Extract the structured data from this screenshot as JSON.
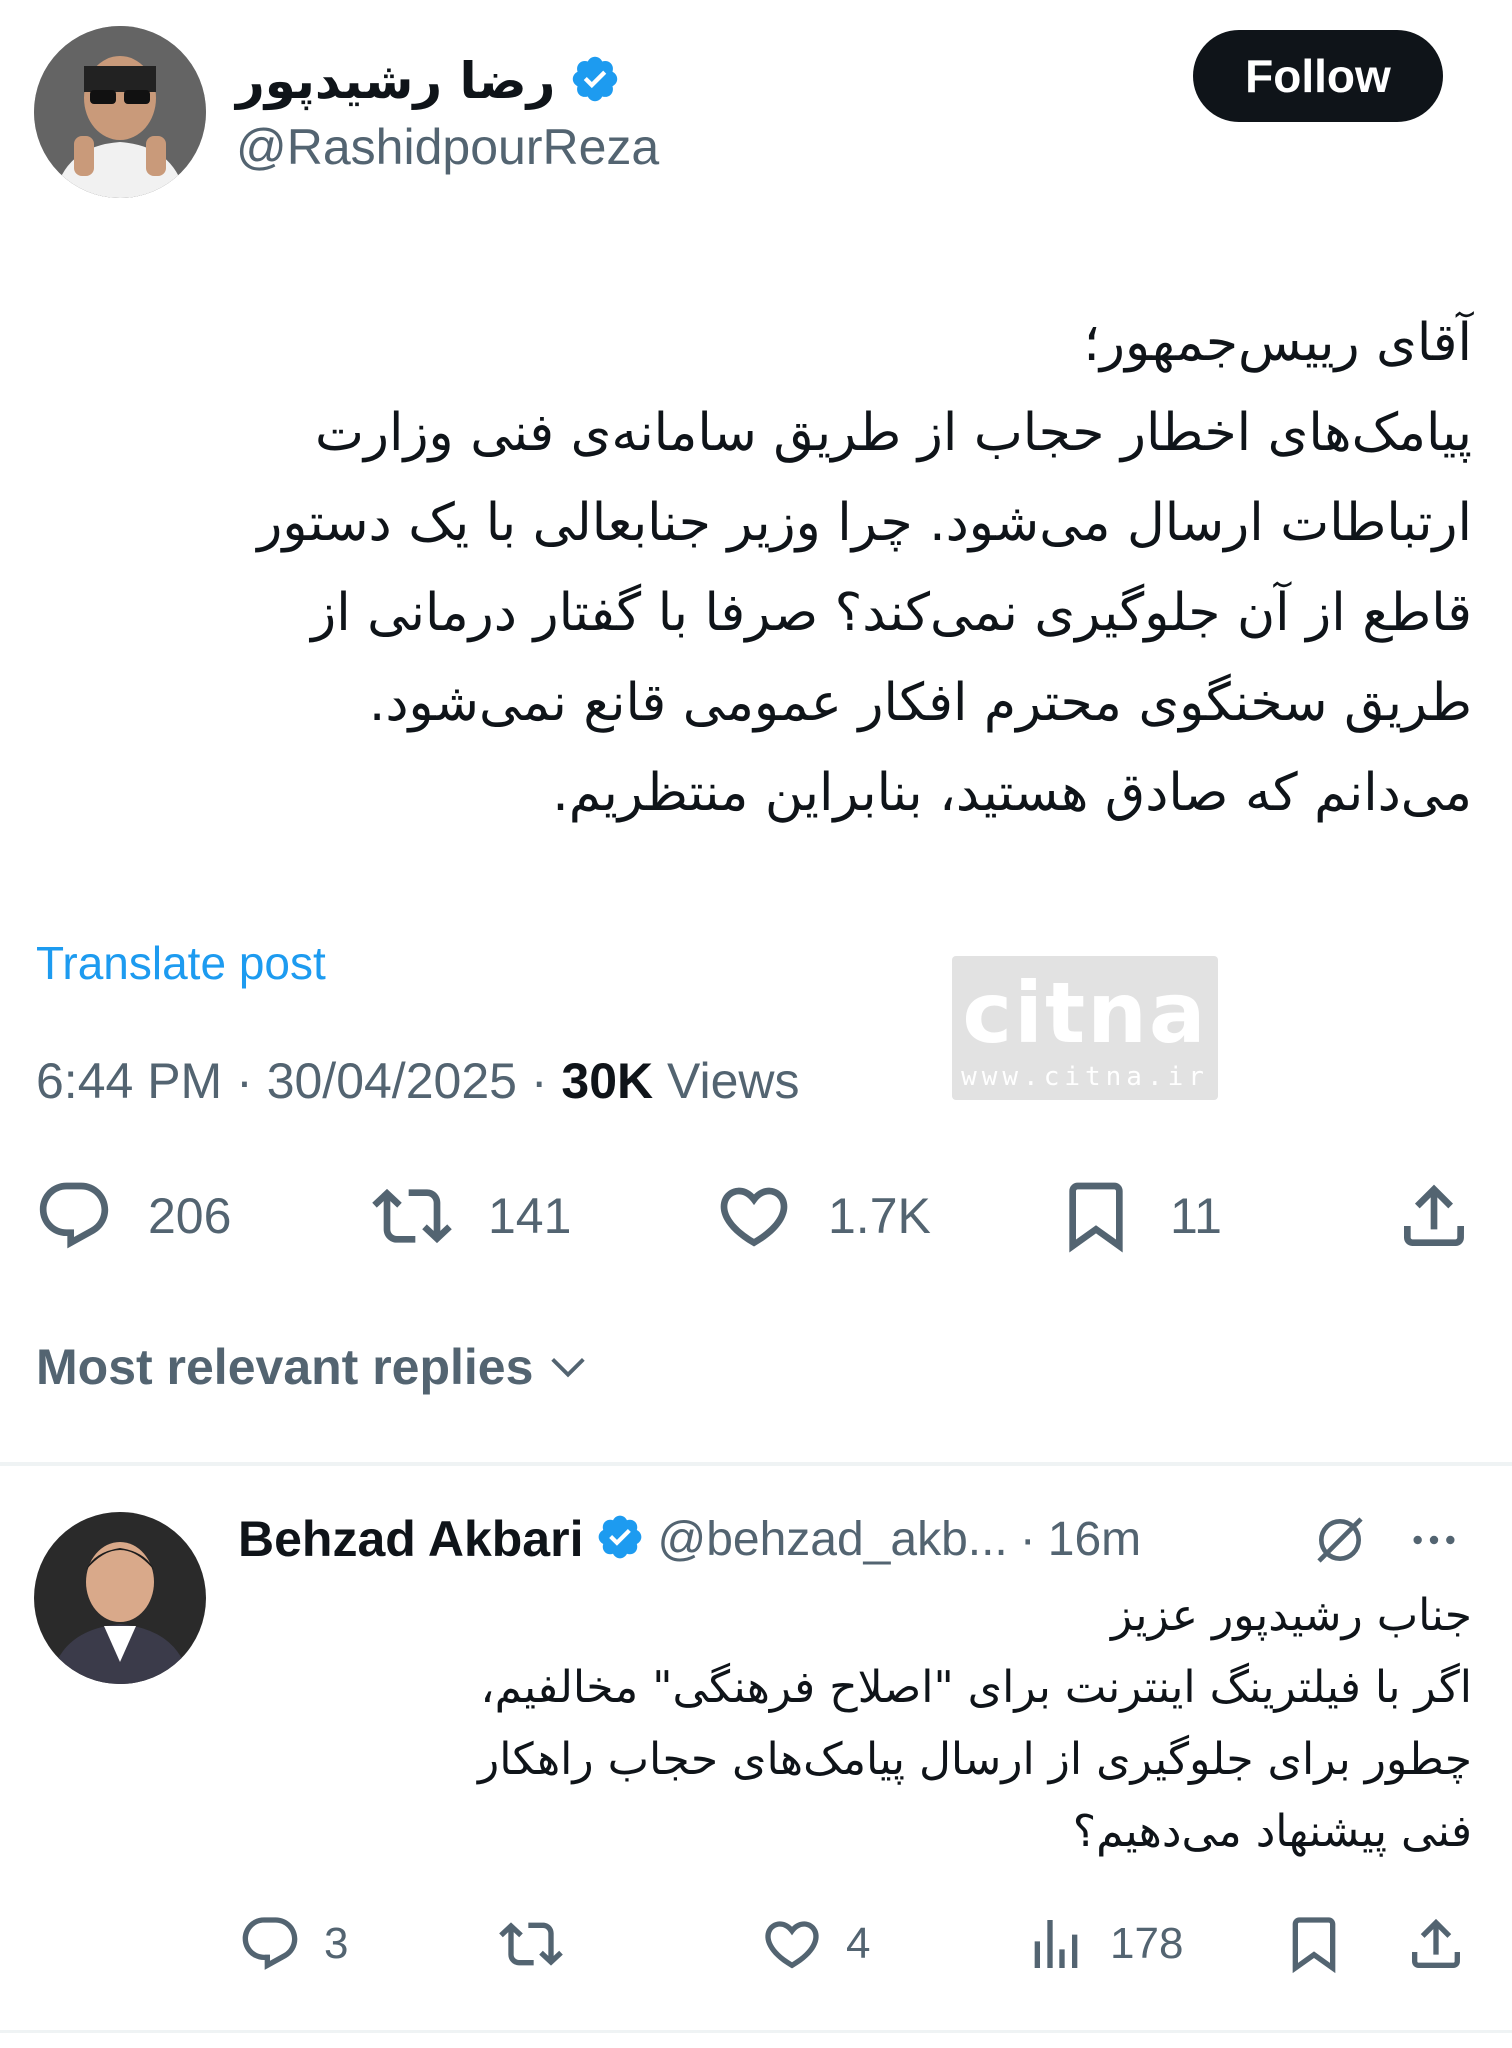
{
  "author": {
    "display_name": "رضا رشیدپور",
    "handle": "@RashidpourReza",
    "avatar_icon": "person-avatar",
    "verified_icon": "verified-badge-icon"
  },
  "follow_label": "Follow",
  "tweet": {
    "text": "آقای رییس‌جمهور؛\nپیامک‌های اخطار حجاب از طریق سامانه‌ی فنی وزارت\nارتباطات ارسال می‌شود. چرا وزیر جنابعالی با یک دستور\nقاطع از آن جلوگیری نمی‌کند؟ صرفا با گفتار درمانی از\nطریق سخنگوی محترم افکار عمومی قانع نمی‌شود.\nمی‌دانم که صادق هستید، بنابراین منتظریم.",
    "translate_label": "Translate post",
    "time": "6:44 PM",
    "date": "30/04/2025",
    "views_count": "30K",
    "views_label": "Views",
    "separator": "·"
  },
  "watermark": {
    "logo": "citna",
    "url": "www.citna.ir"
  },
  "actions": {
    "replies": "206",
    "reposts": "141",
    "likes": "1.7K",
    "bookmarks": "11"
  },
  "replies_section": {
    "sort_label": "Most relevant replies"
  },
  "reply": {
    "display_name": "Behzad Akbari",
    "handle": "@behzad_akb...",
    "time": "16m",
    "separator": "·",
    "text": "جناب رشیدپور عزیز\nاگر با فیلترینگ اینترنت برای \"اصلاح فرهنگی\" مخالفیم،\nچطور برای جلوگیری از ارسال پیامک‌های حجاب راهکار\nفنی پیشنهاد می‌دهیم؟",
    "actions": {
      "replies": "3",
      "likes": "4",
      "views": "178"
    }
  },
  "colors": {
    "text": "#0f1419",
    "secondary": "#536471",
    "link": "#1d9bf0",
    "verified": "#1d9bf0",
    "divider": "#eff3f4"
  }
}
